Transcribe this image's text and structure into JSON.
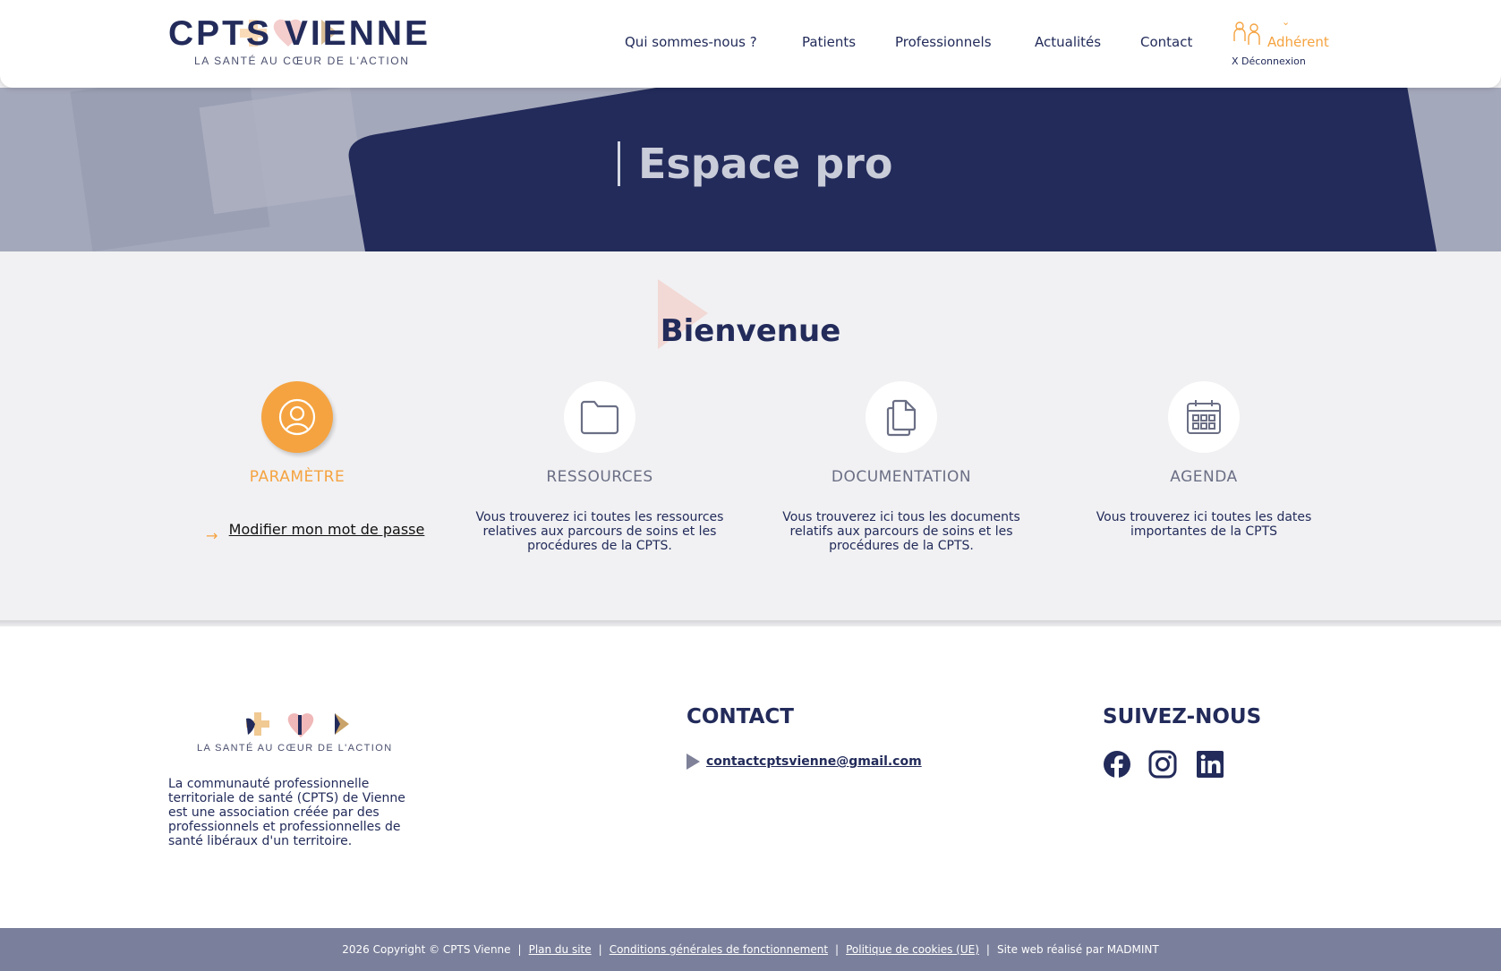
{
  "header": {
    "logo_text": "CPTS VIENNE",
    "logo_tagline": "LA SANTÉ AU CŒUR DE L'ACTION",
    "nav": [
      {
        "label": "Qui sommes-nous ?"
      },
      {
        "label": "Patients"
      },
      {
        "label": "Professionnels"
      },
      {
        "label": "Actualités"
      },
      {
        "label": "Contact"
      }
    ],
    "member_label": "Adhérent",
    "logout_label": "X Déconnexion"
  },
  "hero": {
    "title": "Espace pro"
  },
  "main": {
    "title": "Bienvenue",
    "cards": [
      {
        "title": "PARAMÈTRE",
        "icon": "user-icon",
        "description": ""
      },
      {
        "title": "RESSOURCES",
        "icon": "folder-icon",
        "description": "Vous trouverez ici toutes les ressources relatives aux parcours de soins et les procédures de la CPTS."
      },
      {
        "title": "DOCUMENTATION",
        "icon": "documents-icon",
        "description": "Vous trouverez ici tous les documents relatifs aux parcours de soins et les procédures de la CPTS."
      },
      {
        "title": "AGENDA",
        "icon": "calendar-icon",
        "description": "Vous trouverez ici toutes les dates importantes de la CPTS"
      }
    ],
    "password_link": "Modifier mon mot de passe"
  },
  "footer": {
    "tagline": "LA SANTÉ AU CŒUR DE L'ACTION",
    "description": "La communauté professionnelle territoriale de santé (CPTS) de Vienne est une association créée par des professionnels et professionnelles de santé libéraux d'un territoire.",
    "contact_title": "CONTACT",
    "email": "contactcptsvienne@gmail.com",
    "follow_title": "SUIVEZ-NOUS",
    "social": [
      "facebook-icon",
      "instagram-icon",
      "linkedin-icon"
    ]
  },
  "bottom_bar": {
    "copyright": "2026 Copyright © CPTS Vienne",
    "links": [
      "Plan du site",
      "Conditions générales de fonctionnement",
      "Politique de cookies (UE)"
    ],
    "credit": "Site web réalisé par MADMINT"
  },
  "colors": {
    "navy": "#222b5a",
    "orange": "#f5a340",
    "gray_bar": "#7a7f9b"
  }
}
